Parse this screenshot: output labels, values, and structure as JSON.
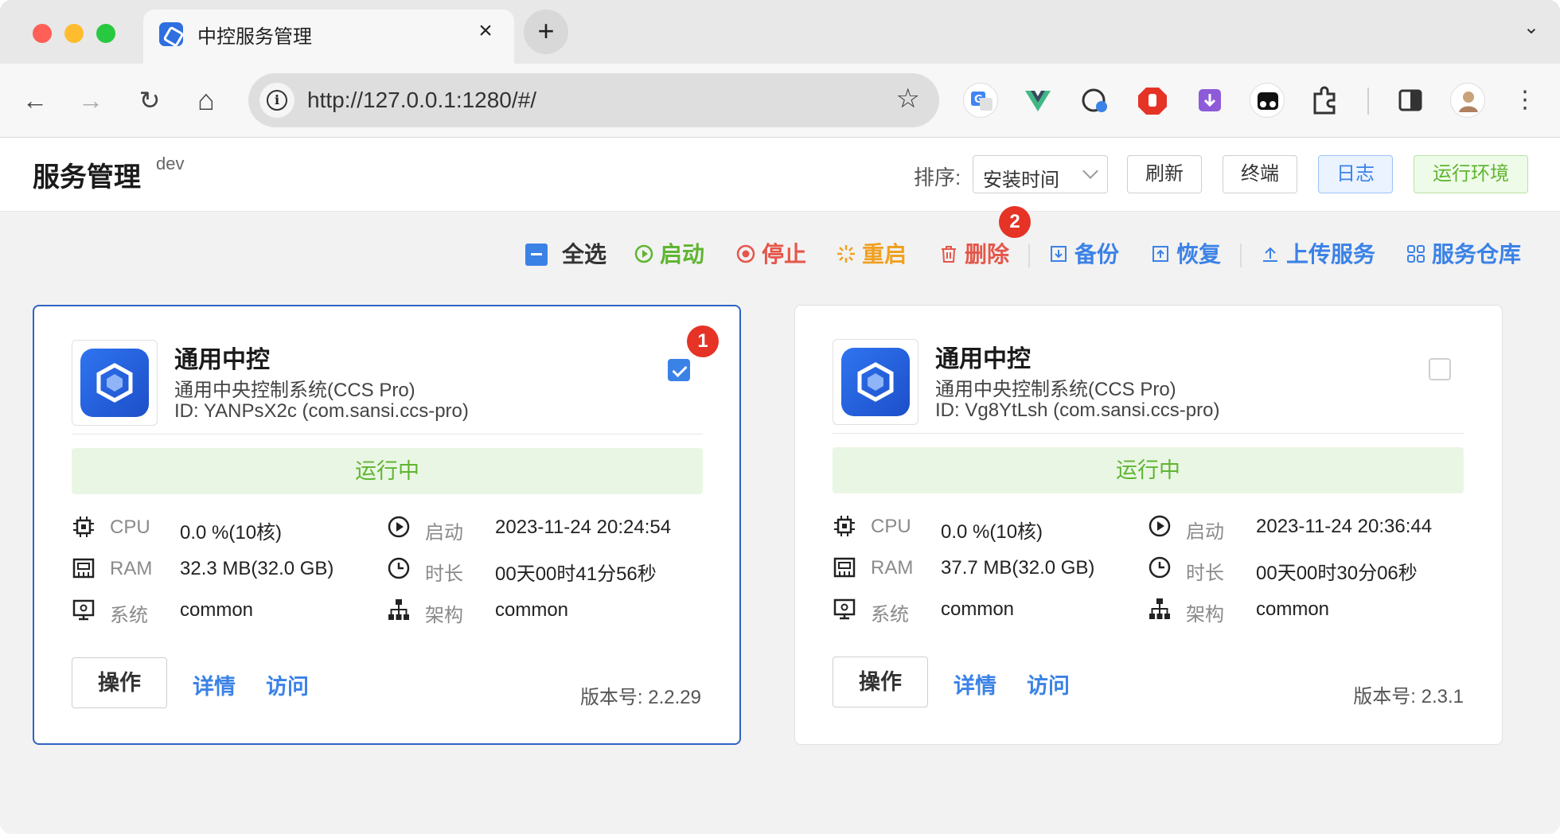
{
  "browser": {
    "tab_title": "中控服务管理",
    "url": "http://127.0.0.1:1280/#/",
    "close_glyph": "×",
    "new_tab_glyph": "+",
    "tab_menu_glyph": "⌄",
    "back_glyph": "←",
    "forward_glyph": "→",
    "reload_glyph": "↻",
    "home_glyph": "⌂",
    "info_glyph": "i",
    "star_glyph": "☆",
    "extensions": [
      "translate-icon",
      "vue-devtools-icon",
      "password-icon",
      "adblock-icon",
      "download-icon",
      "tampermonkey-icon",
      "puzzle-icon",
      "sidepanel-icon",
      "profile-avatar"
    ]
  },
  "header": {
    "title": "服务管理",
    "env": "dev",
    "sort_label": "排序:",
    "sort_value": "安装时间",
    "refresh": "刷新",
    "terminal": "终端",
    "logs": "日志",
    "runtime_env": "运行环境"
  },
  "actions": {
    "select_all": "全选",
    "start": "启动",
    "stop": "停止",
    "restart": "重启",
    "delete": "删除",
    "backup": "备份",
    "restore": "恢复",
    "upload": "上传服务",
    "repository": "服务仓库"
  },
  "badges": {
    "one": "1",
    "two": "2"
  },
  "labels": {
    "cpu": "CPU",
    "ram": "RAM",
    "system": "系统",
    "start_time": "启动",
    "duration": "时长",
    "arch": "架构",
    "operate": "操作",
    "details": "详情",
    "visit": "访问"
  },
  "cards": [
    {
      "name": "通用中控",
      "description": "通用中央控制系统(CCS Pro)",
      "id_line": "ID: YANPsX2c (com.sansi.ccs-pro)",
      "selected": true,
      "status": "运行中",
      "cpu": "0.0 %(10核)",
      "ram": "32.3 MB(32.0 GB)",
      "system": "common",
      "start_time": "2023-11-24 20:24:54",
      "duration": "00天00时41分56秒",
      "arch": "common",
      "version": "版本号: 2.2.29"
    },
    {
      "name": "通用中控",
      "description": "通用中央控制系统(CCS Pro)",
      "id_line": "ID: Vg8YtLsh (com.sansi.ccs-pro)",
      "selected": false,
      "status": "运行中",
      "cpu": "0.0 %(10核)",
      "ram": "37.7 MB(32.0 GB)",
      "system": "common",
      "start_time": "2023-11-24 20:36:44",
      "duration": "00天00时30分06秒",
      "arch": "common",
      "version": "版本号: 2.3.1"
    }
  ],
  "colors": {
    "accent": "#3b82e6",
    "running": "#5fb531",
    "stop": "#e5564a",
    "restart": "#f0a020",
    "selected_border": "#2f63c4"
  }
}
